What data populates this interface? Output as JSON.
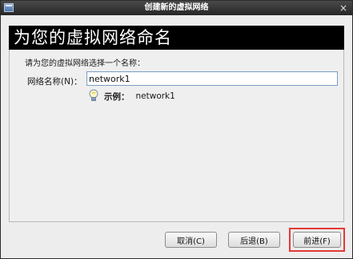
{
  "window": {
    "title": "创建新的虚拟网络",
    "close_glyph": "×"
  },
  "banner": {
    "heading": "为您的虚拟网络命名"
  },
  "form": {
    "instruction": "请为您的虚拟网络选择一个名称：",
    "name_label": "网络名称(N)：",
    "name_value": "network1",
    "example_key": "示例：",
    "example_value": "network1",
    "hint_icon": "lightbulb-icon"
  },
  "buttons": {
    "cancel": "取消(C)",
    "back": "后退(B)",
    "forward": "前进(F)"
  },
  "colors": {
    "highlight": "#e53935",
    "banner_bg": "#000000",
    "titlebar_bg": "#262626"
  }
}
